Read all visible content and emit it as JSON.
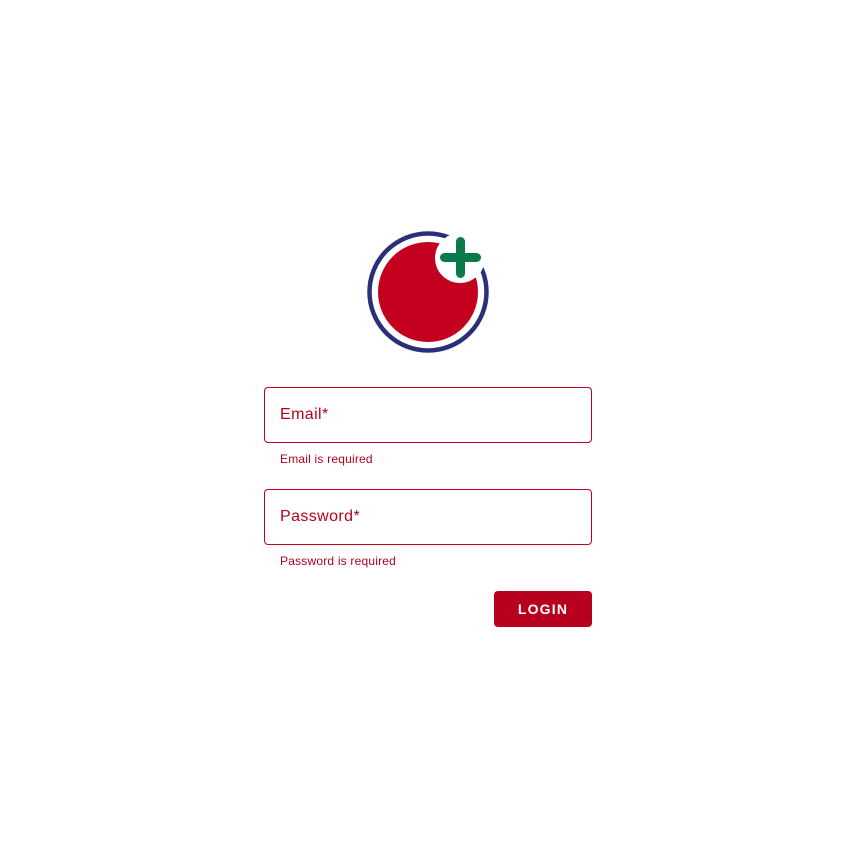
{
  "brand": {
    "logo_icon": "medical-cross-circle-icon",
    "colors": {
      "ring": "#2b2f7a",
      "circle": "#c4001f",
      "cross": "#0a7a4b",
      "accent": "#b8001f"
    }
  },
  "form": {
    "email": {
      "label": "Email*",
      "value": "",
      "error": "Email is required"
    },
    "password": {
      "label": "Password*",
      "value": "",
      "error": "Password is required"
    },
    "submit_label": "LOGIN"
  }
}
